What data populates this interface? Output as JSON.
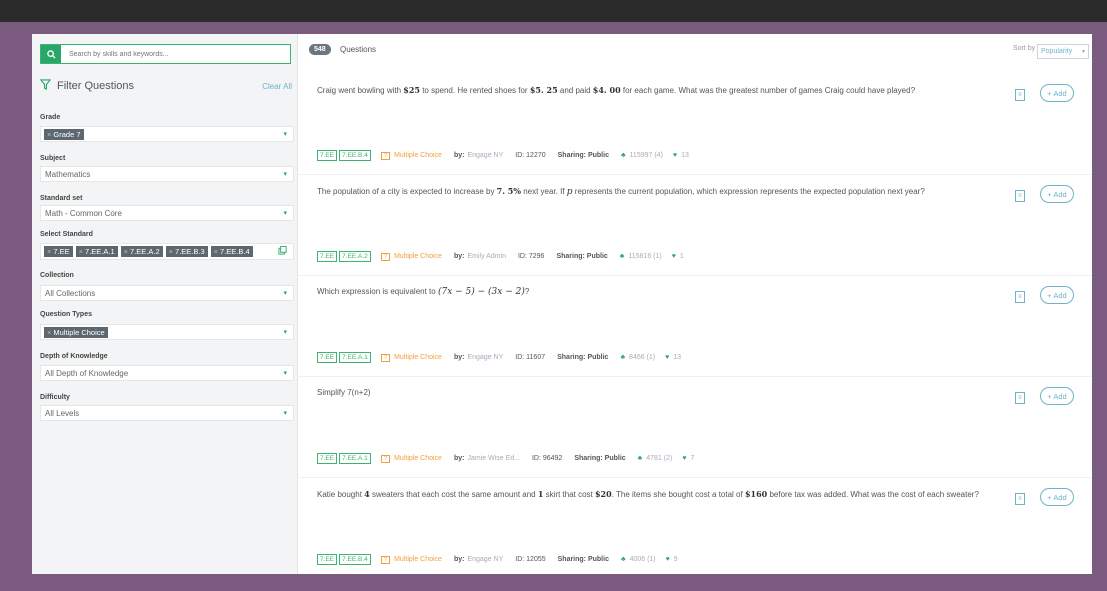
{
  "search": {
    "placeholder": "Search by skills and keywords..."
  },
  "filters": {
    "title": "Filter Questions",
    "clear_label": "Clear All",
    "grade": {
      "label": "Grade",
      "chips": [
        "Grade 7"
      ]
    },
    "subject": {
      "label": "Subject",
      "value": "Mathematics"
    },
    "standard_set": {
      "label": "Standard set",
      "value": "Math - Common Core"
    },
    "select_standard": {
      "label": "Select Standard",
      "chips": [
        "7.EE",
        "7.EE.A.1",
        "7.EE.A.2",
        "7.EE.B.3",
        "7.EE.B.4"
      ]
    },
    "collection": {
      "label": "Collection",
      "value": "All Collections"
    },
    "question_types": {
      "label": "Question Types",
      "chips": [
        "Multiple Choice"
      ]
    },
    "dok": {
      "label": "Depth of Knowledge",
      "value": "All Depth of Knowledge"
    },
    "difficulty": {
      "label": "Difficulty",
      "value": "All Levels"
    }
  },
  "header": {
    "count": "548",
    "label": "Questions",
    "sort_label": "Sort by",
    "sort_value": "Popularity"
  },
  "add_label": "+ Add",
  "questions": [
    {
      "text_parts": [
        "Craig went bowling with ",
        "$25",
        " to spend. He rented shoes for ",
        "$5. 25",
        " and paid ",
        "$4. 00",
        " for each game. What was the greatest number of games Craig could have played?"
      ],
      "tags": [
        "7.EE",
        "7.EE.B.4"
      ],
      "type": "Multiple Choice",
      "by": "by:",
      "author": "Engage NY",
      "id": "ID: 12270",
      "sharing": "Sharing: Public",
      "uses": "115997 (4)",
      "likes": "13"
    },
    {
      "text_parts": [
        "The population of a city is expected to increase by ",
        "7. 5%",
        " next year. If ",
        "p",
        " represents the current population, which expression represents the expected population next year?"
      ],
      "tags": [
        "7.EE",
        "7.EE.A.2"
      ],
      "type": "Multiple Choice",
      "by": "by:",
      "author": "Emily Admin",
      "id": "ID: 7296",
      "sharing": "Sharing: Public",
      "uses": "115816 (1)",
      "likes": "1"
    },
    {
      "text_parts": [
        "Which expression is equivalent to ",
        "(7x − 5) − (3x − 2)",
        "?"
      ],
      "tags": [
        "7.EE",
        "7.EE.A.1"
      ],
      "type": "Multiple Choice",
      "by": "by:",
      "author": "Engage NY",
      "id": "ID: 11607",
      "sharing": "Sharing: Public",
      "uses": "8466 (1)",
      "likes": "13"
    },
    {
      "text_parts": [
        "Simplify 7(n+2)"
      ],
      "tags": [
        "7.EE",
        "7.EE.A.1"
      ],
      "type": "Multiple Choice",
      "by": "by:",
      "author": "Jamie Wise Ed...",
      "id": "ID: 96492",
      "sharing": "Sharing: Public",
      "uses": "4781 (2)",
      "likes": "7"
    },
    {
      "text_parts": [
        "Katie bought ",
        "4",
        " sweaters that each cost the same amount and ",
        "1",
        " skirt that cost ",
        "$20",
        ". The items she bought cost a total of ",
        "$160",
        " before tax was added. What was the cost of each sweater?"
      ],
      "tags": [
        "7.EE",
        "7.EE.B.4"
      ],
      "type": "Multiple Choice",
      "by": "by:",
      "author": "Engage NY",
      "id": "ID: 12055",
      "sharing": "Sharing: Public",
      "uses": "4006 (1)",
      "likes": "9"
    }
  ],
  "colors": {
    "accent": "#2aa66a",
    "link": "#6fb3c9",
    "frame": "#7a5a7e",
    "mc": "#f0a040"
  }
}
